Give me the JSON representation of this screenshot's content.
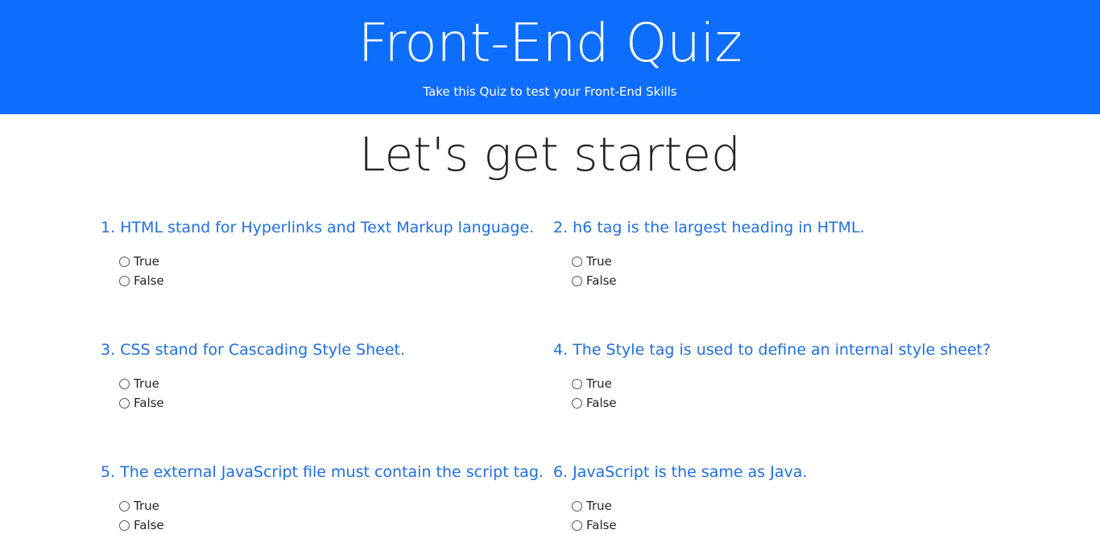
{
  "header": {
    "title": "Front-End Quiz",
    "subtitle": "Take this Quiz to test your Front-End Skills"
  },
  "intro": {
    "heading": "Let's get started"
  },
  "questions": [
    {
      "text": "1. HTML stand for Hyperlinks and Text Markup language.",
      "options": [
        "True",
        "False"
      ]
    },
    {
      "text": "2. h6 tag is the largest heading in HTML.",
      "options": [
        "True",
        "False"
      ]
    },
    {
      "text": "3. CSS stand for Cascading Style Sheet.",
      "options": [
        "True",
        "False"
      ]
    },
    {
      "text": "4. The Style tag is used to define an internal style sheet?",
      "options": [
        "True",
        "False"
      ]
    },
    {
      "text": "5. The external JavaScript file must contain the script tag.",
      "options": [
        "True",
        "False"
      ]
    },
    {
      "text": "6. JavaScript is the same as Java.",
      "options": [
        "True",
        "False"
      ]
    }
  ],
  "colors": {
    "header_bg": "#0d6efd",
    "question_text": "#1f6fe0"
  }
}
